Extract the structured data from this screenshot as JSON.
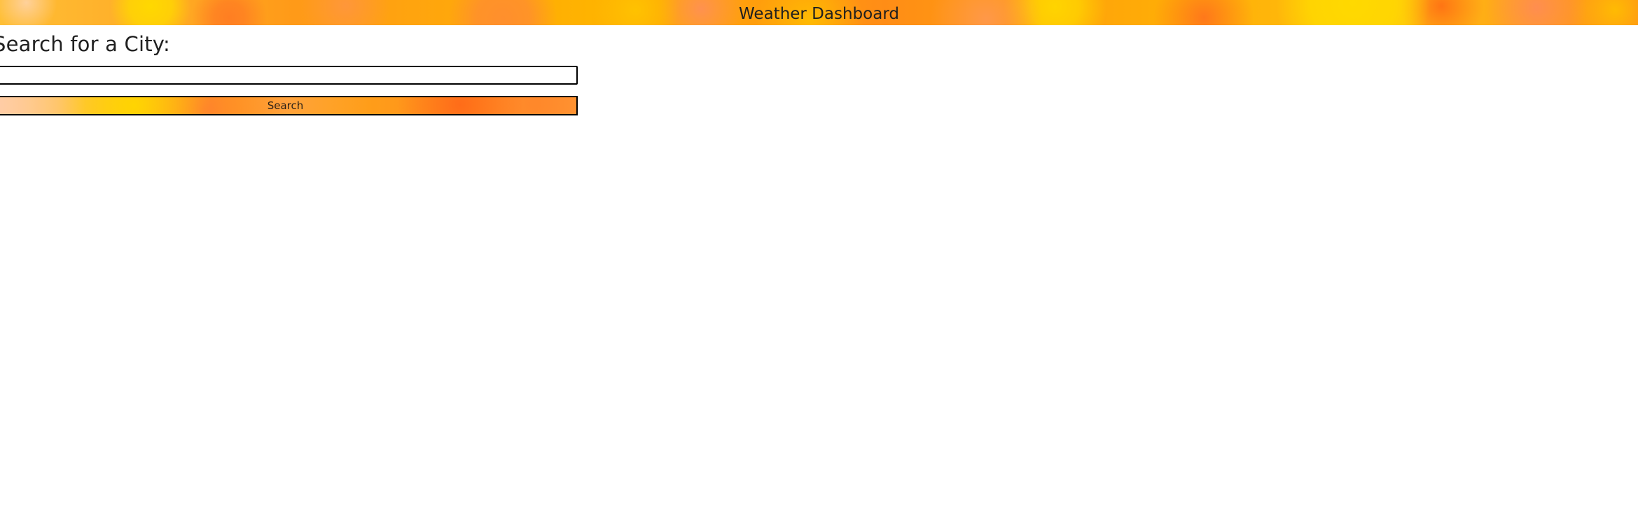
{
  "header": {
    "title": "Weather Dashboard"
  },
  "search": {
    "heading": "Search for a City:",
    "input_value": "",
    "placeholder": "",
    "button_label": "Search"
  },
  "colors": {
    "background": "#ffffff",
    "header_gradient_primary": "#ffb300",
    "header_gradient_secondary": "#ff8a1c",
    "text": "#222222",
    "border": "#000000"
  }
}
